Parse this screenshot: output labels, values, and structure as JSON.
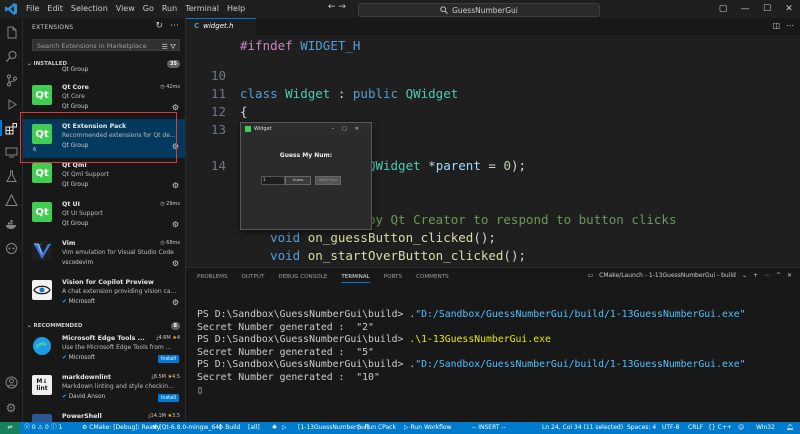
{
  "titlebar": {
    "menu": [
      "File",
      "Edit",
      "Selection",
      "View",
      "Go",
      "Run",
      "Terminal",
      "Help"
    ],
    "search": "GuessNumberGui"
  },
  "sidebar": {
    "title": "EXTENSIONS",
    "search_placeholder": "Search Extensions in Marketplace",
    "installed_label": "INSTALLED",
    "installed_count": "35",
    "recommended_label": "RECOMMENDED",
    "recommended_count": "8",
    "installed": [
      {
        "name": "Qt Core",
        "desc": "Qt Core",
        "publisher": "Qt Group",
        "meta": "42ms",
        "logo": "Qt"
      },
      {
        "name": "Qt Extension Pack",
        "desc": "Recommended extensions for Qt de...",
        "publisher": "Qt Group",
        "meta": "",
        "logo": "Qt",
        "count": "6"
      },
      {
        "name": "Qt Qml",
        "desc": "Qt Qml Support",
        "publisher": "Qt Group",
        "meta": "",
        "logo": "Qt"
      },
      {
        "name": "Qt UI",
        "desc": "Qt UI Support",
        "publisher": "Qt Group",
        "meta": "29ms",
        "logo": "Qt"
      },
      {
        "name": "Vim",
        "desc": "Vim emulation for Visual Studio Code",
        "publisher": "vscodevim",
        "meta": "68ms",
        "logo": "vim"
      },
      {
        "name": "Vision for Copilot Preview",
        "desc": "A chat extension providing vision ca...",
        "publisher": "Microsoft",
        "meta": "",
        "logo": "eye"
      }
    ],
    "recommended": [
      {
        "name": "Microsoft Edge Tools ...",
        "desc": "Use the Microsoft Edge Tools from ...",
        "publisher": "Microsoft",
        "downloads": "4.6M",
        "rating": "4",
        "action": "Install"
      },
      {
        "name": "markdownlint",
        "desc": "Markdown linting and style checkin...",
        "publisher": "David Anson",
        "downloads": "8.5M",
        "rating": "4.5",
        "action": "Install"
      },
      {
        "name": "PowerShell",
        "desc": "",
        "publisher": "",
        "downloads": "14.1M",
        "rating": "3.5",
        "action": ""
      }
    ]
  },
  "editor": {
    "tab_label": "widget.h",
    "lines": [
      {
        "num": "",
        "parts": [
          [
            "pp",
            "#ifndef "
          ],
          [
            "mac",
            "WIDGET_H"
          ]
        ]
      },
      {
        "num": "10",
        "parts": []
      },
      {
        "num": "11",
        "parts": [
          [
            "kw",
            "class "
          ],
          [
            "cls",
            "Widget"
          ],
          [
            "txt",
            " : "
          ],
          [
            "kw",
            "public "
          ],
          [
            "cls",
            "QWidget"
          ]
        ]
      },
      {
        "num": "12",
        "parts": [
          [
            "txt",
            "{"
          ]
        ]
      },
      {
        "num": "13",
        "parts": [
          [
            "txt",
            "    "
          ],
          [
            "mac",
            "Q_OBJECT"
          ]
        ]
      },
      {
        "num": "",
        "parts": []
      },
      {
        "num": "14",
        "parts": [
          [
            "txt",
            "               "
          ],
          [
            "fn",
            "t"
          ],
          [
            "txt",
            "("
          ],
          [
            "cls",
            "QWidget"
          ],
          [
            "txt",
            " *"
          ],
          [
            "pm",
            "parent"
          ],
          [
            "txt",
            " = "
          ],
          [
            "num",
            "0"
          ],
          [
            "txt",
            ");"
          ]
        ]
      },
      {
        "num": "",
        "parts": []
      },
      {
        "num": "",
        "parts": []
      },
      {
        "num": "",
        "parts": [
          [
            "cm",
            "    //     rated by Qt Creator to respond to button clicks"
          ]
        ]
      },
      {
        "num": "",
        "parts": [
          [
            "txt",
            "    "
          ],
          [
            "kw",
            "void "
          ],
          [
            "fn",
            "on_guessButton_clicked"
          ],
          [
            "txt",
            "();"
          ]
        ]
      },
      {
        "num": "",
        "parts": [
          [
            "txt",
            "    "
          ],
          [
            "kw",
            "void "
          ],
          [
            "fn",
            "on_startOverButton_clicked"
          ],
          [
            "txt",
            "();"
          ]
        ]
      }
    ]
  },
  "qt_window": {
    "title": "Widget",
    "label": "Guess My Num:",
    "input_value": "1",
    "guess_btn": "Guess",
    "start_over_btn": "Start Over"
  },
  "panel": {
    "tabs": [
      "PROBLEMS",
      "OUTPUT",
      "DEBUG CONSOLE",
      "TERMINAL",
      "PORTS",
      "COMMENTS"
    ],
    "active_tab": "TERMINAL",
    "terminal_name": "CMake/Launch - 1-13GuessNumberGui - build",
    "terminal_lines": [
      {
        "prompt": "PS D:\\Sandbox\\GuessNumberGui\\build> .",
        "str": "\"D:/Sandbox/GuessNumberGui/build/1-13GuessNumberGui.exe\""
      },
      {
        "prompt": "Secret Number generated :  \"2\"",
        "str": ""
      },
      {
        "prompt": "PS D:\\Sandbox\\GuessNumberGui\\build> ",
        "str": ".\\1-13GuessNumberGui.exe"
      },
      {
        "prompt": "Secret Number generated :  \"5\"",
        "str": ""
      },
      {
        "prompt": "PS D:\\Sandbox\\GuessNumberGui\\build> .",
        "str": "\"D:/Sandbox/GuessNumberGui/build/1-13GuessNumberGui.exe\""
      },
      {
        "prompt": "Secret Number generated :  \"10\"",
        "str": ""
      }
    ]
  },
  "status": {
    "errors": "0",
    "warnings": "0",
    "info": "1",
    "cmake": "CMake: [Debug]: Ready",
    "kit": "[Qt-6.8.0-mingw_64]",
    "build": "Build",
    "target": "[all]",
    "launch": "[1-13GuessNumberGui]",
    "cpack": "Run CPack",
    "workflow": "Run Workflow",
    "mode": "-- INSERT --",
    "position": "Ln 24, Col 34 (11 selected)",
    "spaces": "Spaces: 4",
    "encoding": "UTF-8",
    "eol": "CRLF",
    "language": "C++",
    "platform": "Win32"
  },
  "colors": {
    "accent": "#007acc",
    "qt_green": "#41cd52",
    "highlight_box": "#e03a3a"
  }
}
